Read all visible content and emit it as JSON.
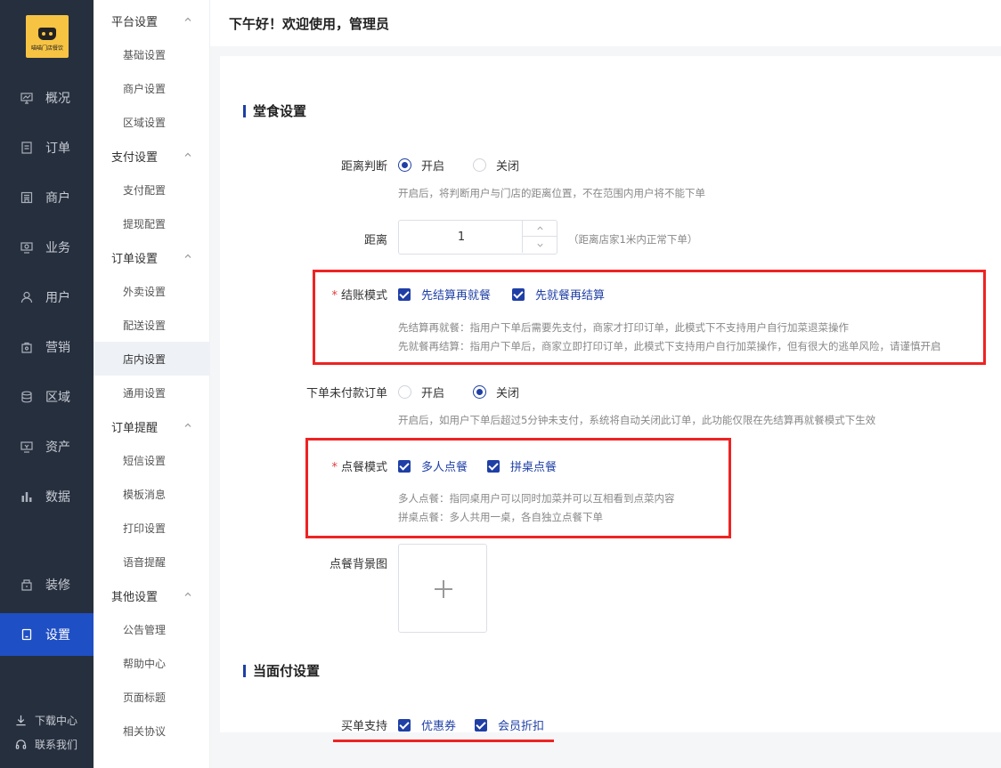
{
  "app": {
    "logo_text": "喵喵门店餐饮"
  },
  "rail": {
    "items": [
      {
        "icon": "monitor-icon",
        "label": "概况"
      },
      {
        "icon": "order-icon",
        "label": "订单"
      },
      {
        "icon": "shop-icon",
        "label": "商户"
      },
      {
        "icon": "business-icon",
        "label": "业务"
      },
      {
        "icon": "user-icon",
        "label": "用户"
      },
      {
        "icon": "marketing-icon",
        "label": "营销"
      },
      {
        "icon": "region-icon",
        "label": "区域"
      },
      {
        "icon": "assets-icon",
        "label": "资产"
      },
      {
        "icon": "chart-icon",
        "label": "数据"
      },
      {
        "icon": "decorate-icon",
        "label": "装修"
      },
      {
        "icon": "settings-icon",
        "label": "设置"
      }
    ],
    "active": "设置",
    "footer": [
      {
        "icon": "download-icon",
        "label": "下载中心"
      },
      {
        "icon": "headset-icon",
        "label": "联系我们"
      }
    ]
  },
  "submenu": {
    "groups": [
      {
        "label": "平台设置",
        "items": [
          "基础设置",
          "商户设置",
          "区域设置"
        ]
      },
      {
        "label": "支付设置",
        "items": [
          "支付配置",
          "提现配置"
        ]
      },
      {
        "label": "订单设置",
        "items": [
          "外卖设置",
          "配送设置",
          "店内设置",
          "通用设置"
        ]
      },
      {
        "label": "订单提醒",
        "items": [
          "短信设置",
          "模板消息",
          "打印设置",
          "语音提醒"
        ]
      },
      {
        "label": "其他设置",
        "items": [
          "公告管理",
          "帮助中心",
          "页面标题",
          "相关协议"
        ]
      }
    ],
    "active": "店内设置"
  },
  "header": {
    "greeting": "下午好！欢迎使用，管理员"
  },
  "dine_in": {
    "title": "堂食设置",
    "distance_check": {
      "label": "距离判断",
      "options": [
        "开启",
        "关闭"
      ],
      "selected": "开启",
      "hint": "开启后，将判断用户与门店的距离位置，不在范围内用户将不能下单"
    },
    "distance": {
      "label": "距离",
      "value": "1",
      "hint": "（距离店家1米内正常下单）"
    },
    "checkout_mode": {
      "label": "结账模式",
      "required": "*",
      "options": [
        "先结算再就餐",
        "先就餐再结算"
      ],
      "checked": [
        true,
        true
      ],
      "hint_1": "先结算再就餐：指用户下单后需要先支付，商家才打印订单，此模式下不支持用户自行加菜退菜操作",
      "hint_2": "先就餐再结算：指用户下单后，商家立即打印订单，此模式下支持用户自行加菜操作，但有很大的逃单风险，请谨慎开启"
    },
    "unpaid_order": {
      "label": "下单未付款订单",
      "options": [
        "开启",
        "关闭"
      ],
      "selected": "关闭",
      "hint": "开启后，如用户下单后超过5分钟未支付，系统将自动关闭此订单，此功能仅限在先结算再就餐模式下生效"
    },
    "order_mode": {
      "label": "点餐模式",
      "required": "*",
      "options": [
        "多人点餐",
        "拼桌点餐"
      ],
      "checked": [
        true,
        true
      ],
      "hint_1": "多人点餐：指同桌用户可以同时加菜并可以互相看到点菜内容",
      "hint_2": "拼桌点餐：多人共用一桌，各自独立点餐下单"
    },
    "background": {
      "label": "点餐背景图"
    }
  },
  "face_pay": {
    "title": "当面付设置",
    "support": {
      "label": "买单支持",
      "options": [
        "优惠券",
        "会员折扣"
      ],
      "checked": [
        true,
        true
      ]
    }
  },
  "colors": {
    "rail_bg": "#262f3e",
    "accent": "#1f3fa6",
    "active_rail": "#1f4fc4",
    "highlight": "#ee2323",
    "logo": "#f6c343"
  }
}
